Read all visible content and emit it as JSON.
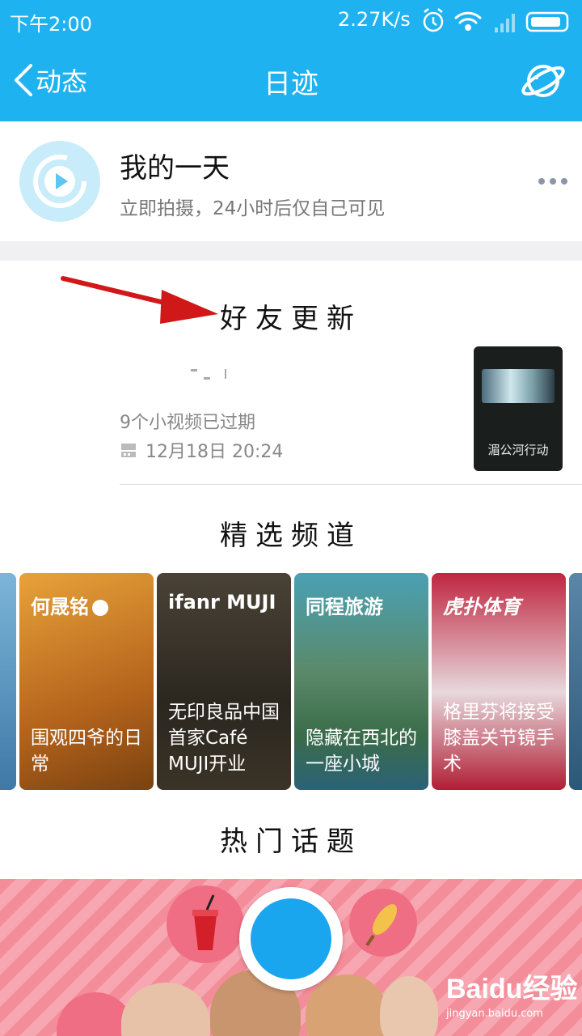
{
  "status_bar": {
    "time": "下午2:00",
    "speed": "2.27K/s"
  },
  "nav": {
    "back_label": "动态",
    "title": "日迹"
  },
  "my_day": {
    "title": "我的一天",
    "subtitle": "立即拍摄，24小时后仅自己可见"
  },
  "friend_section": {
    "title": "好友更新",
    "expired_text": "9个小视频已过期",
    "date": "12月18日 20:24",
    "thumb_caption": "湄公河行动"
  },
  "channels_section": {
    "title": "精选频道",
    "cards": [
      {
        "brand": "何晟铭",
        "text": "围观四爷的日常",
        "color": "#c77a22"
      },
      {
        "brand": "ifanr MUJI",
        "text": "无印良品中国首家Café MUJI开业",
        "color": "#3b352b"
      },
      {
        "brand": "同程旅游",
        "text": "隐藏在西北的一座小城",
        "color": "#3f8a86"
      },
      {
        "brand": "虎扑体育",
        "text": "格里芬将接受膝盖关节镜手术",
        "color": "#b01e35"
      }
    ]
  },
  "hot_section": {
    "title": "热门话题"
  },
  "watermark": {
    "brand": "Baidu经验",
    "url": "jingyan.baidu.com"
  },
  "colors": {
    "accent": "#1fb2f0",
    "shoot_button": "#1aa6ee",
    "hot_bg": "#f48d9a"
  }
}
